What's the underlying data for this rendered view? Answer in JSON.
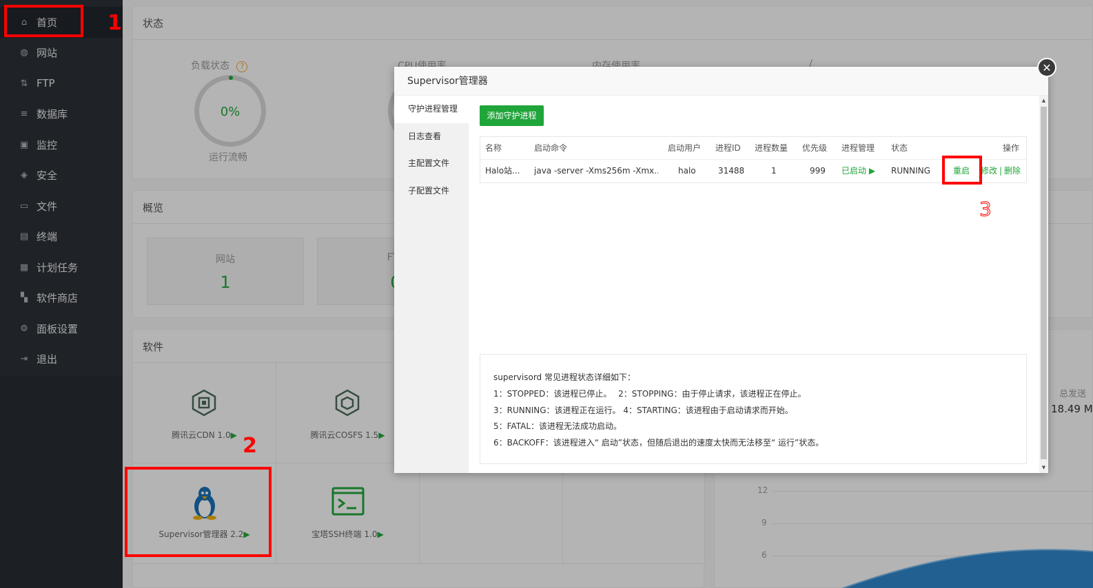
{
  "sidebar": {
    "items": [
      {
        "label": "首页",
        "icon": "home-icon",
        "active": true
      },
      {
        "label": "网站",
        "icon": "globe-icon"
      },
      {
        "label": "FTP",
        "icon": "ftp-icon"
      },
      {
        "label": "数据库",
        "icon": "database-icon"
      },
      {
        "label": "监控",
        "icon": "monitor-icon"
      },
      {
        "label": "安全",
        "icon": "shield-icon"
      },
      {
        "label": "文件",
        "icon": "folder-icon"
      },
      {
        "label": "终端",
        "icon": "terminal-icon"
      },
      {
        "label": "计划任务",
        "icon": "calendar-icon"
      },
      {
        "label": "软件商店",
        "icon": "grid-icon"
      },
      {
        "label": "面板设置",
        "icon": "gear-icon"
      },
      {
        "label": "退出",
        "icon": "logout-icon"
      }
    ]
  },
  "status_card": {
    "title": "状态",
    "load_label": "负载状态",
    "load_help": "?",
    "load_value": "0%",
    "load_desc": "运行流畅",
    "cpu_label": "CPU使用率",
    "mem_label": "内存使用率",
    "disk_label": "/"
  },
  "overview_card": {
    "title": "概览",
    "site_label": "网站",
    "site_value": "1",
    "ftp_label": "FTP",
    "ftp_value": "0"
  },
  "software_card": {
    "title": "软件",
    "items": [
      {
        "name": "腾讯云CDN 1.0",
        "icon": "tencent-cdn-icon"
      },
      {
        "name": "腾讯云COSFS 1.5",
        "icon": "tencent-cosfs-icon"
      },
      {
        "name": "Supervisor管理器 2.2",
        "icon": "linux-penguin-icon"
      },
      {
        "name": "宝塔SSH终端 1.0",
        "icon": "terminal-icon"
      }
    ],
    "play": "▶"
  },
  "traffic_card": {
    "total_label": "总发送",
    "total_value": "18.49 M",
    "y_ticks": [
      "12",
      "9",
      "6"
    ]
  },
  "modal": {
    "title": "Supervisor管理器",
    "close": "✕",
    "tabs": [
      "守护进程管理",
      "日志查看",
      "主配置文件",
      "子配置文件"
    ],
    "add_button": "添加守护进程",
    "table": {
      "headers": [
        "名称",
        "启动命令",
        "启动用户",
        "进程ID",
        "进程数量",
        "优先级",
        "进程管理",
        "状态",
        "操作"
      ],
      "rows": [
        {
          "name": "Halo站...",
          "command": "java -server -Xms256m -Xmx...",
          "user": "halo",
          "pid": "31488",
          "count": "1",
          "priority": "999",
          "manage": "已启动 ▶",
          "status": "RUNNING",
          "op_restart": "重启",
          "op_edit": "修改",
          "op_sep": "|",
          "op_delete": "删除"
        }
      ]
    },
    "info": {
      "heading": "supervisord 常见进程状态详细如下：",
      "lines": [
        "1：STOPPED：该进程已停止。　 2：STOPPING：由于停止请求，该进程正在停止。",
        "3：RUNNING：该进程正在运行。 4：STARTING：该进程由于启动请求而开始。",
        "5：FATAL：该进程无法成功启动。",
        "6：BACKOFF：该进程进入“ 启动”状态，但随后退出的速度太快而无法移至“ 运行”状态。"
      ]
    }
  },
  "annotations": {
    "one": "1",
    "two": "2",
    "three": "3",
    "color": "#ff0000"
  },
  "colors": {
    "accent_green": "#20a53a",
    "sidebar_bg": "#2c3138"
  }
}
